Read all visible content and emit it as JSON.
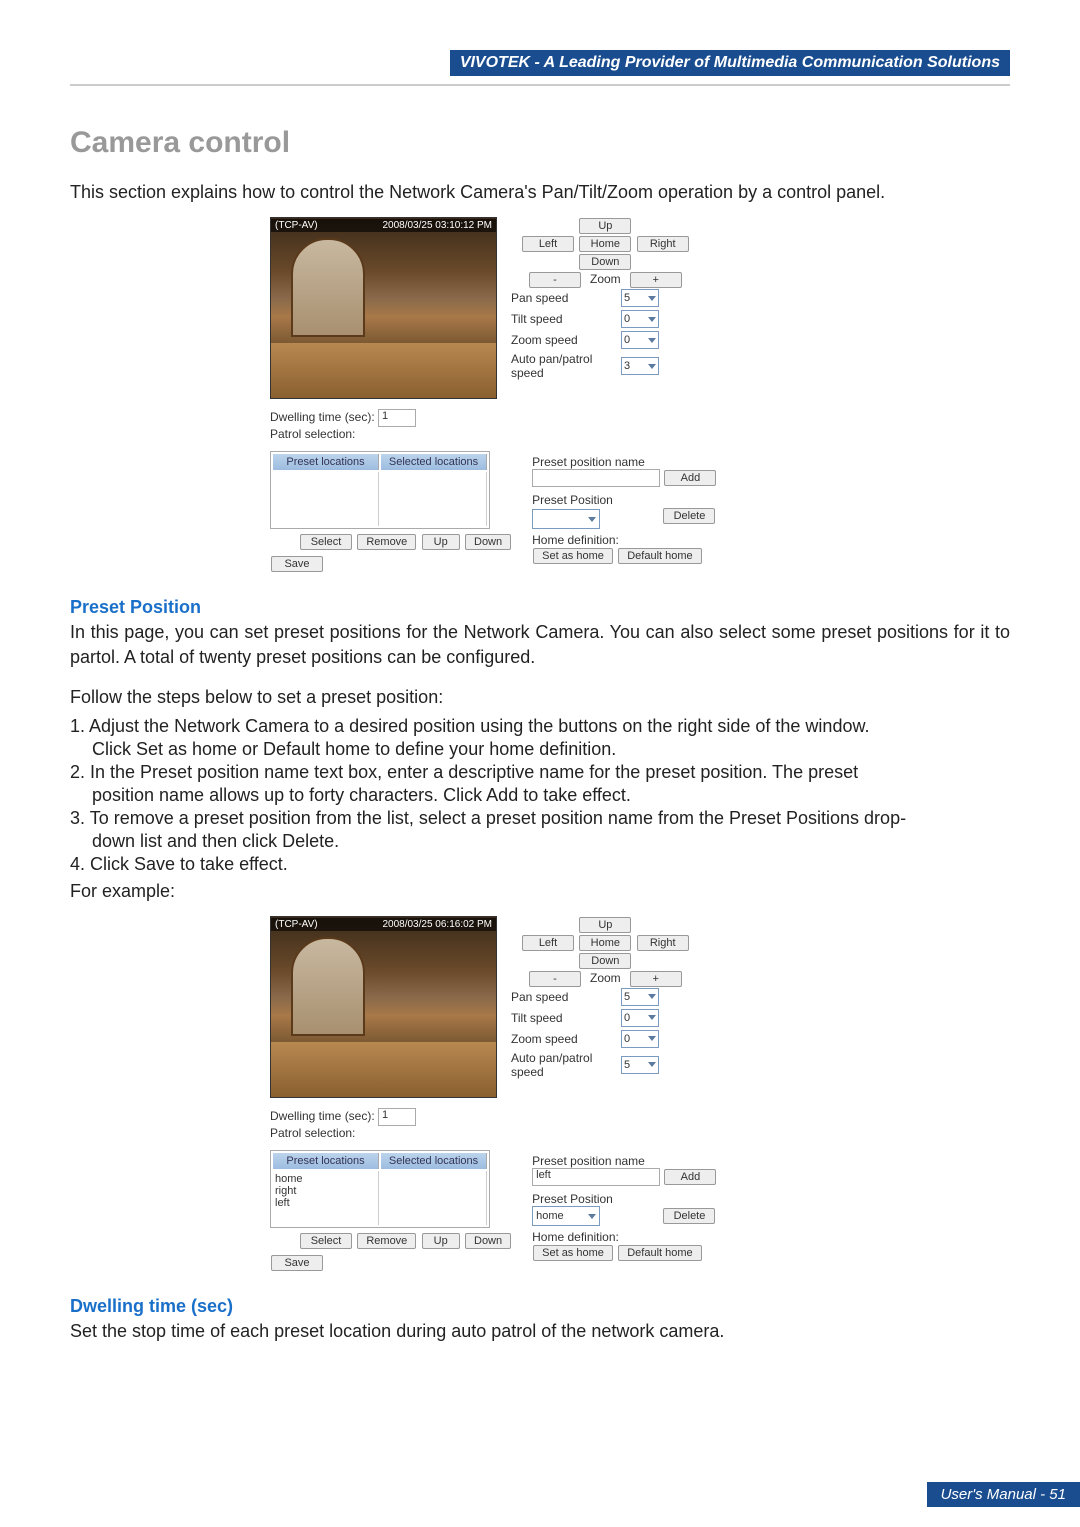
{
  "header": {
    "banner": "VIVOTEK - A Leading Provider of Multimedia Communication Solutions"
  },
  "title": "Camera control",
  "intro": "This section explains how to control the Network Camera's Pan/Tilt/Zoom operation by a control panel.",
  "panel1": {
    "cam_label": "(TCP-AV)",
    "cam_time": "2008/03/25 03:10:12 PM",
    "btn_up": "Up",
    "btn_left": "Left",
    "btn_home": "Home",
    "btn_right": "Right",
    "btn_down": "Down",
    "btn_zoom_out": "-",
    "lbl_zoom": "Zoom",
    "btn_zoom_in": "+",
    "lbl_pan_speed": "Pan speed",
    "val_pan_speed": "5",
    "lbl_tilt_speed": "Tilt speed",
    "val_tilt_speed": "0",
    "lbl_zoom_speed": "Zoom speed",
    "val_zoom_speed": "0",
    "lbl_auto_speed": "Auto pan/patrol speed",
    "val_auto_speed": "3",
    "lbl_dwell": "Dwelling time (sec):",
    "val_dwell": "1",
    "lbl_patrol_sel": "Patrol selection:",
    "th_preset": "Preset locations",
    "th_selected": "Selected locations",
    "preset_items": "",
    "btn_select": "Select",
    "btn_remove": "Remove",
    "btn_up2": "Up",
    "btn_down2": "Down",
    "btn_save": "Save",
    "lbl_preset_name": "Preset position name",
    "val_preset_name": "",
    "btn_add": "Add",
    "lbl_preset_pos": "Preset Position",
    "val_preset_pos": "",
    "btn_delete": "Delete",
    "lbl_home_def": "Home definition:",
    "btn_set_home": "Set as home",
    "btn_default_home": "Default home"
  },
  "preset_heading": "Preset Position",
  "preset_para": "In this page, you can set preset positions for the Network Camera. You can also select some preset positions for it to partol. A total of twenty preset positions can be configured.",
  "steps_intro": "Follow the steps below to set a preset position:",
  "step1a": "1. Adjust the Network Camera to a desired position using the buttons on the right side of the window.",
  "step1b": "    Click Set as home or Default home to define your home definition.",
  "step2a": "2. In the Preset position name text box, enter a descriptive name for the preset position. The preset",
  "step2b": "    position name allows up to forty characters. Click Add to take effect.",
  "step3a": "3. To remove a preset position from the list, select a preset position name from the Preset Positions drop-",
  "step3b": "    down list and then click Delete.",
  "step4": "4. Click Save to take effect.",
  "example_label": "For example:",
  "panel2": {
    "cam_label": "(TCP-AV)",
    "cam_time": "2008/03/25 06:16:02 PM",
    "btn_up": "Up",
    "btn_left": "Left",
    "btn_home": "Home",
    "btn_right": "Right",
    "btn_down": "Down",
    "btn_zoom_out": "-",
    "lbl_zoom": "Zoom",
    "btn_zoom_in": "+",
    "lbl_pan_speed": "Pan speed",
    "val_pan_speed": "5",
    "lbl_tilt_speed": "Tilt speed",
    "val_tilt_speed": "0",
    "lbl_zoom_speed": "Zoom speed",
    "val_zoom_speed": "0",
    "lbl_auto_speed": "Auto pan/patrol speed",
    "val_auto_speed": "5",
    "lbl_dwell": "Dwelling time (sec):",
    "val_dwell": "1",
    "lbl_patrol_sel": "Patrol selection:",
    "th_preset": "Preset locations",
    "th_selected": "Selected locations",
    "preset_items": "home\nright\nleft",
    "btn_select": "Select",
    "btn_remove": "Remove",
    "btn_up2": "Up",
    "btn_down2": "Down",
    "btn_save": "Save",
    "lbl_preset_name": "Preset position name",
    "val_preset_name": "left",
    "btn_add": "Add",
    "lbl_preset_pos": "Preset Position",
    "val_preset_pos": "home",
    "btn_delete": "Delete",
    "lbl_home_def": "Home definition:",
    "btn_set_home": "Set as home",
    "btn_default_home": "Default home"
  },
  "dwell_heading": "Dwelling time (sec)",
  "dwell_para": "Set the stop time of each preset location during auto patrol of the network camera.",
  "footer": "User's Manual - 51"
}
